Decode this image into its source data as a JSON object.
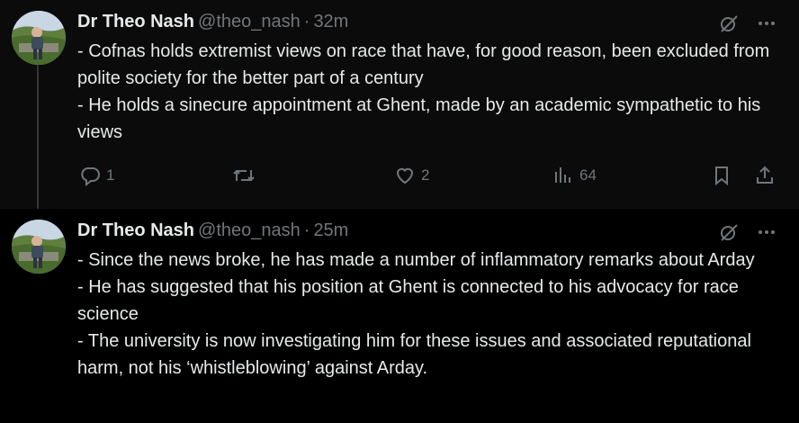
{
  "tweets": [
    {
      "name": "Dr Theo Nash",
      "handle": "@theo_nash",
      "separator": "·",
      "time": "32m",
      "lines": [
        "- Cofnas holds extremist views on race that have, for good reason, been excluded from polite society for the better part of a century",
        "- He holds a sinecure appointment at Ghent, made by an academic sympathetic to his views"
      ],
      "replies": "1",
      "reposts": "",
      "likes": "2",
      "views": "64"
    },
    {
      "name": "Dr Theo Nash",
      "handle": "@theo_nash",
      "separator": "·",
      "time": "25m",
      "lines": [
        "- Since the news broke, he has made a number of inflammatory remarks about Arday",
        "- He has suggested that his position at Ghent is connected to his advocacy for race science",
        "- The university is now investigating him for these issues and associated reputational harm, not his ‘whistleblowing’ against Arday."
      ]
    }
  ],
  "icons": {
    "grok": "grok-icon",
    "more": "more-icon",
    "reply": "reply-icon",
    "repost": "repost-icon",
    "like": "like-icon",
    "views": "views-icon",
    "bookmark": "bookmark-icon",
    "share": "share-icon"
  }
}
